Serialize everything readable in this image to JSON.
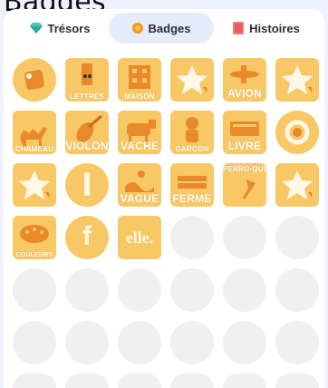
{
  "header": {
    "title": "Badges"
  },
  "tabs": [
    {
      "label": "Trésors",
      "icon": "gem-icon",
      "active": false
    },
    {
      "label": "Badges",
      "icon": "coin-icon",
      "active": true
    },
    {
      "label": "Histoires",
      "icon": "book-icon",
      "active": false
    }
  ],
  "badges": {
    "lettres": "LETTRES",
    "maison": "MAISON",
    "avion": "AVION",
    "chameau": "CHAMEAU",
    "violon": "VIOLON",
    "vache": "VACHE",
    "garcon": "GARÇON",
    "livre": "LIVRE",
    "vague": "VAGUE",
    "ferme": "FERME",
    "perroquet": "PERRO-QUET",
    "couleurs": "COULEURS",
    "f": "f",
    "elle": "elle."
  },
  "colors": {
    "badge_bg": "#f7c865",
    "badge_art": "#e8892b",
    "empty_slot": "#f0f0f0",
    "active_tab": "#e5ecfb",
    "page_bg": "#eef2ff"
  }
}
